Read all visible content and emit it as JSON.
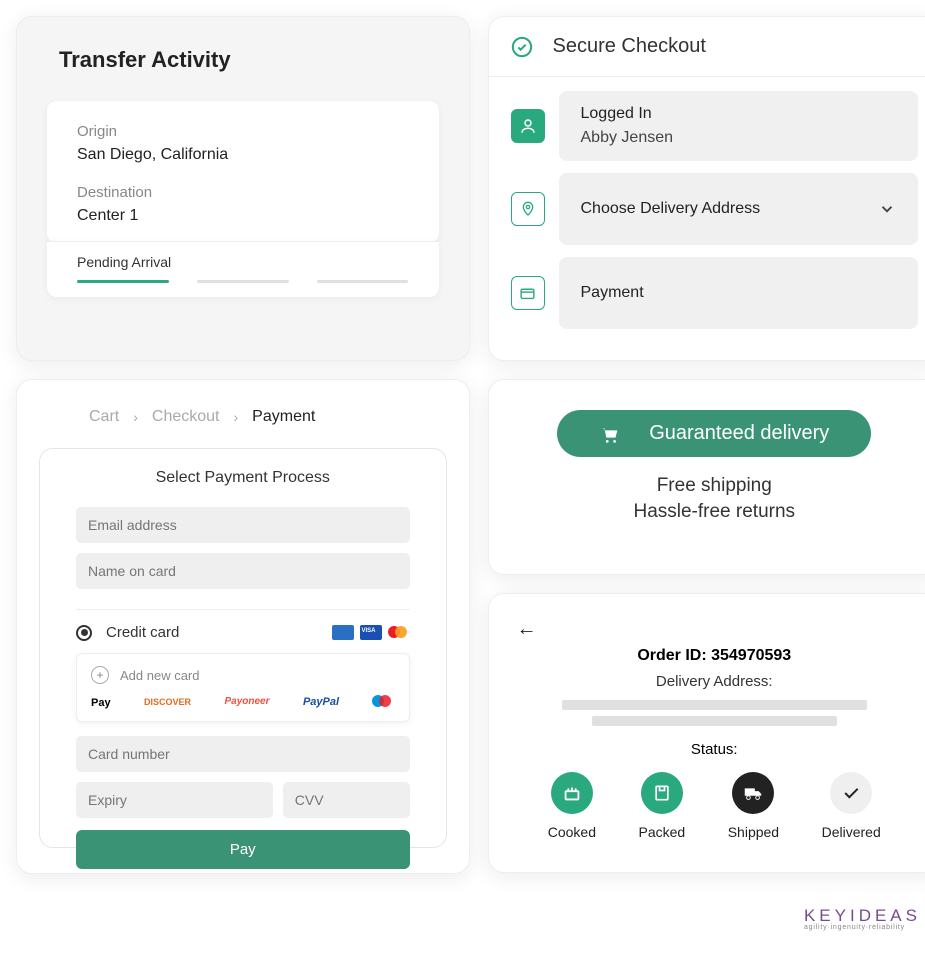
{
  "transfer": {
    "title": "Transfer Activity",
    "origin_label": "Origin",
    "origin_value": "San Diego, California",
    "dest_label": "Destination",
    "dest_value": "Center 1",
    "status": "Pending Arrival"
  },
  "checkout": {
    "title": "Secure Checkout",
    "logged_in": "Logged In",
    "user": "Abby Jensen",
    "address": "Choose Delivery Address",
    "payment": "Payment"
  },
  "payment": {
    "crumbs": {
      "cart": "Cart",
      "checkout": "Checkout",
      "payment": "Payment"
    },
    "panel_title": "Select Payment Process",
    "email_ph": "Email address",
    "name_ph": "Name on card",
    "cc_label": "Credit card",
    "addnew": "Add new card",
    "cardnum_ph": "Card number",
    "expiry_ph": "Expiry",
    "cvv_ph": "CVV",
    "paybtn": "Pay",
    "brands": {
      "apple": "Pay",
      "discover": "DISCOVER",
      "payoneer": "Payoneer",
      "paypal": "PayPal"
    }
  },
  "delivery": {
    "btn": "Guaranteed delivery",
    "l1": "Free shipping",
    "l2": "Hassle-free returns"
  },
  "order": {
    "title": "Order ID: 354970593",
    "addr_label": "Delivery Address:",
    "status_label": "Status:",
    "steps": {
      "cooked": "Cooked",
      "packed": "Packed",
      "shipped": "Shipped",
      "delivered": "Delivered"
    }
  },
  "brand": {
    "name": "KEYIDEAS",
    "tag": "agility·ingenuity·reliability"
  }
}
